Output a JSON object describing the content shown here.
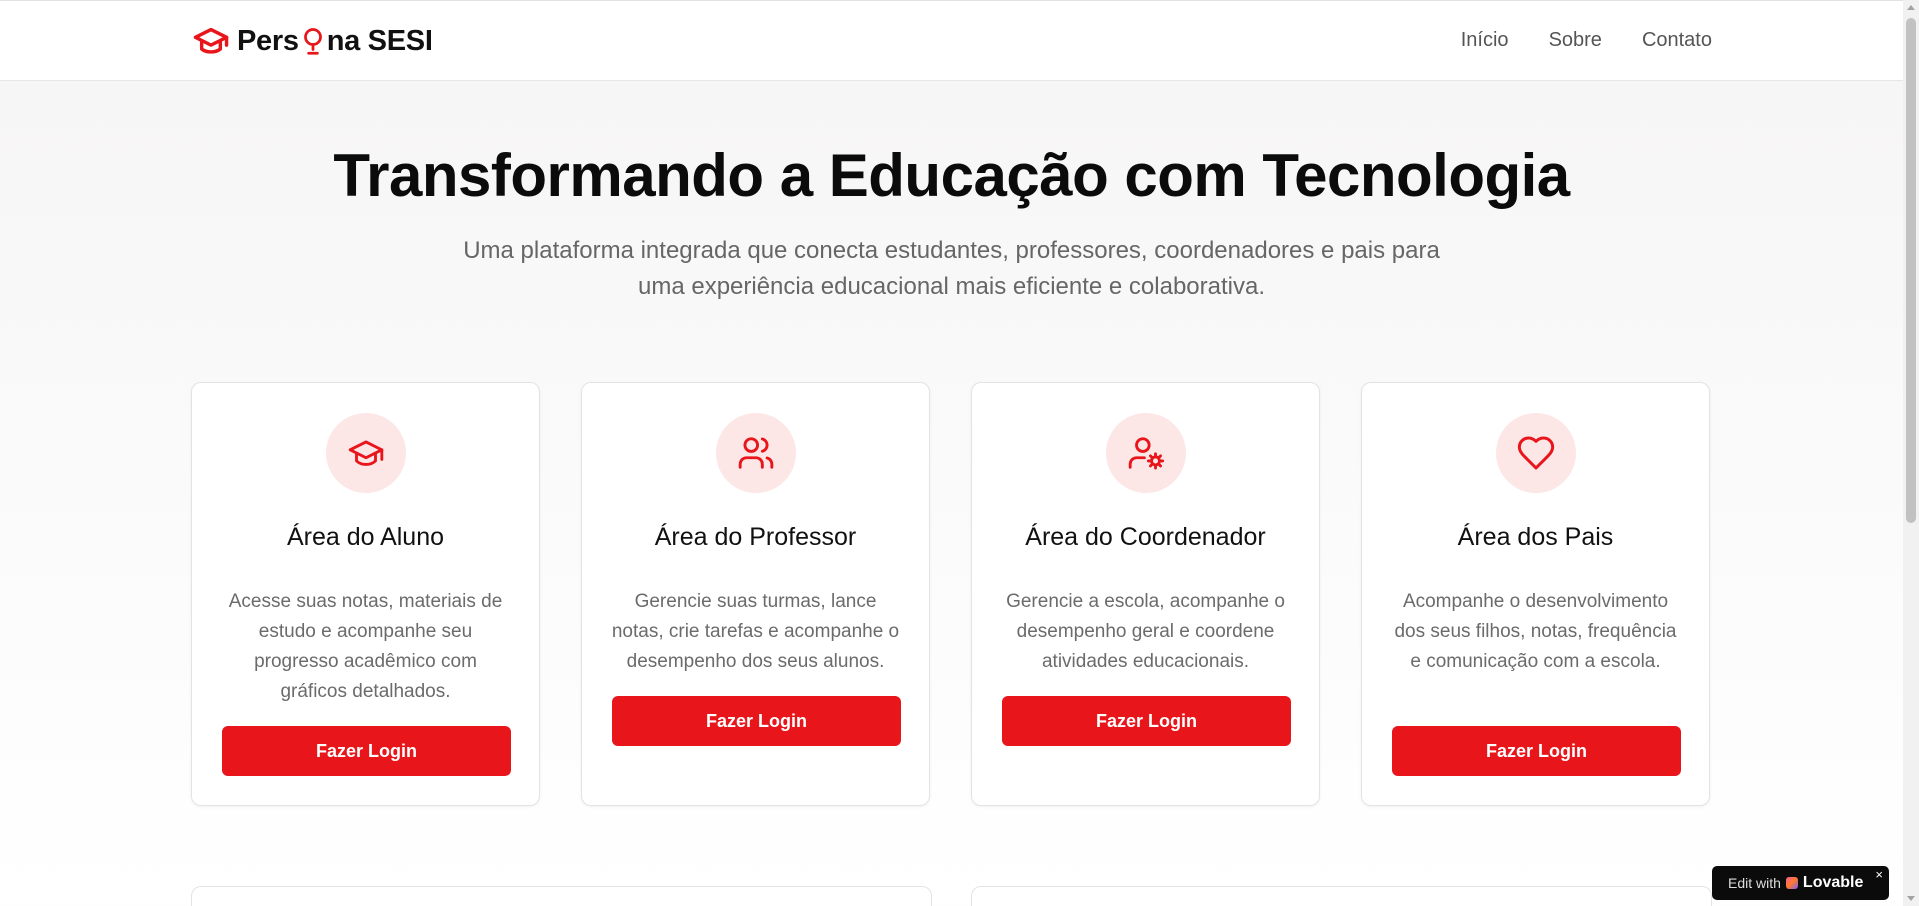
{
  "brand": {
    "name_part1": "Pers",
    "name_part2": "na SESI",
    "accent_color": "#e8151b",
    "logo_icon": "graduation-cap-icon",
    "bulb_icon": "lightbulb-icon"
  },
  "nav": {
    "items": [
      "Início",
      "Sobre",
      "Contato"
    ]
  },
  "hero": {
    "title": "Transformando a Educação com Tecnologia",
    "subtitle": "Uma plataforma integrada que conecta estudantes, professores, coordenadores e pais para uma experiência educacional mais eficiente e colaborativa."
  },
  "cards": [
    {
      "icon": "graduation-cap-icon",
      "title": "Área do Aluno",
      "description": "Acesse suas notas, materiais de estudo e acompanhe seu progresso acadêmico com gráficos detalhados.",
      "button": "Fazer Login"
    },
    {
      "icon": "users-icon",
      "title": "Área do Professor",
      "description": "Gerencie suas turmas, lance notas, crie tarefas e acompanhe o desempenho dos seus alunos.",
      "button": "Fazer Login"
    },
    {
      "icon": "user-cog-icon",
      "title": "Área do Coordenador",
      "description": "Gerencie a escola, acompanhe o desempenho geral e coordene atividades educacionais.",
      "button": "Fazer Login"
    },
    {
      "icon": "heart-icon",
      "title": "Área dos Pais",
      "description": "Acompanhe o desenvolvimento dos seus filhos, notas, frequência e comunicação com a escola.",
      "button": "Fazer Login"
    }
  ],
  "badge": {
    "prefix": "Edit with",
    "brand": "Lovable",
    "close": "×"
  }
}
